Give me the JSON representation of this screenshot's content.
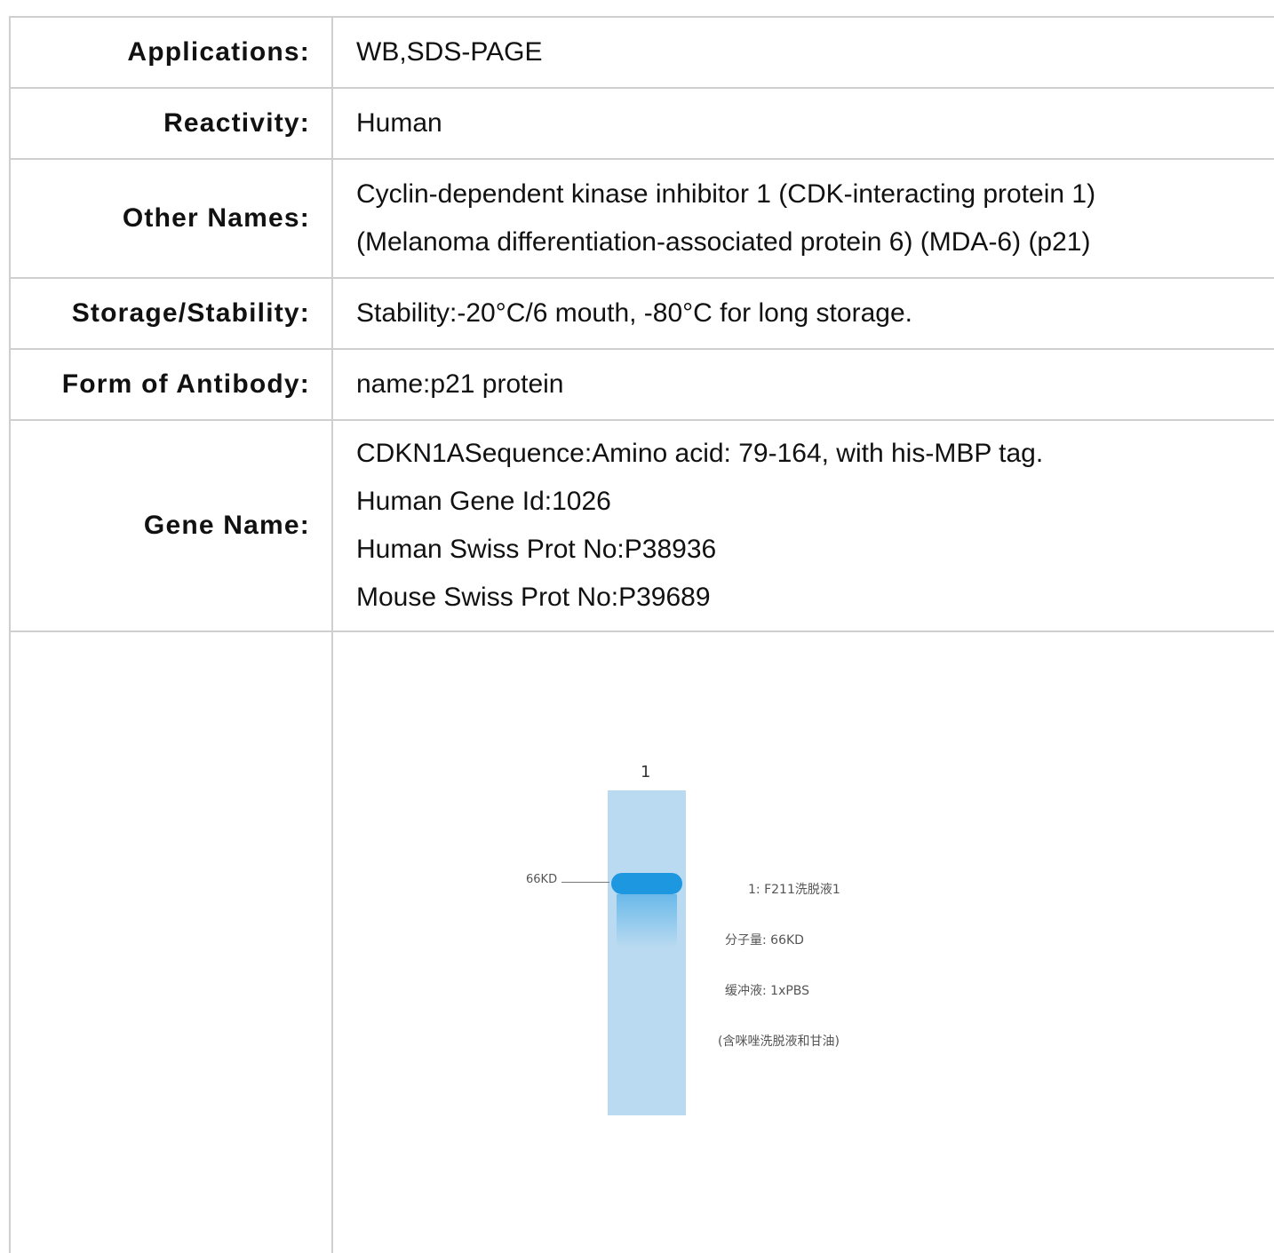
{
  "rows": {
    "applications": {
      "label": "Applications:",
      "value": "WB,SDS-PAGE"
    },
    "reactivity": {
      "label": "Reactivity:",
      "value": "Human"
    },
    "other_names": {
      "label": "Other Names:",
      "lines": [
        "Cyclin-dependent kinase inhibitor 1 (CDK-interacting protein 1)",
        "(Melanoma differentiation-associated protein 6) (MDA-6) (p21)"
      ]
    },
    "storage": {
      "label": "Storage/Stability:",
      "value": "Stability:-20°C/6 mouth, -80°C for long storage."
    },
    "form": {
      "label": "Form of Antibody:",
      "value": "name:p21 protein"
    },
    "gene": {
      "label": "Gene Name:",
      "lines": [
        "CDKN1ASequence:Amino acid: 79-164, with his-MBP tag.",
        "Human Gene Id:1026",
        "Human Swiss Prot No:P38936",
        "Mouse Swiss Prot No:P39689"
      ]
    }
  },
  "gel_image": {
    "lane_label": "1",
    "marker_label": "66KD",
    "legend": [
      "1: F211洗脱液1",
      "分子量: 66KD",
      "缓冲液: 1xPBS",
      "(含咪唑洗脱液和甘油)"
    ]
  }
}
